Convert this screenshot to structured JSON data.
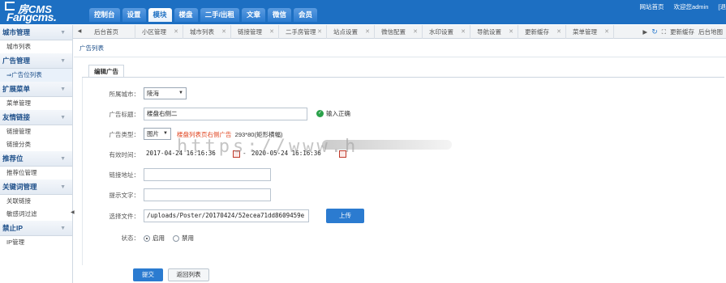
{
  "logo": {
    "line1": "房CMS",
    "line2": "Fangcms."
  },
  "nav": [
    "控制台",
    "设置",
    "模块",
    "楼盘",
    "二手/出租",
    "文章",
    "微信",
    "会员"
  ],
  "nav_active_index": 2,
  "top_links": [
    "网站首页",
    "欢迎您admin",
    "[退"
  ],
  "tabs": [
    "后台首页",
    "小区管理",
    "城市列表",
    "链接管理",
    "二手房管理",
    "站点设置",
    "微信配置",
    "水印设置",
    "导航设置",
    "更新缓存",
    "菜单管理"
  ],
  "tab_tools": {
    "refresh": "更新缓存",
    "map": "后台地图"
  },
  "sidebar": {
    "groups": [
      {
        "title": "城市管理",
        "items": [
          "城市列表"
        ]
      },
      {
        "title": "广告管理",
        "items": [
          "⇒广告位列表"
        ]
      },
      {
        "title": "扩展菜单",
        "items": [
          "菜单管理"
        ]
      },
      {
        "title": "友情链接",
        "items": [
          "链接管理",
          "链接分类"
        ]
      },
      {
        "title": "推荐位",
        "items": [
          "推荐位管理"
        ]
      },
      {
        "title": "关键词管理",
        "items": [
          "关联链接",
          "敏感词过滤"
        ]
      },
      {
        "title": "禁止IP",
        "items": [
          "IP管理"
        ]
      }
    ]
  },
  "breadcrumb": "广告列表",
  "form_tab": "编辑广告",
  "form": {
    "city": {
      "label": "所属城市：",
      "value": "陵海"
    },
    "title": {
      "label": "广告标题：",
      "value": "楼盘右侧二",
      "ok_text": "输入正确"
    },
    "type": {
      "label": "广告类型：",
      "value": "图片",
      "hint_red": "楼盘列表页右侧广告",
      "hint_black": "293*80(矩形横幅)"
    },
    "time": {
      "label": "有效时间：",
      "start": "2017-04-24 16:16:36",
      "sep": "-",
      "end": "2020-05-24 16:16:36"
    },
    "link": {
      "label": "链接地址：",
      "value": ""
    },
    "tip": {
      "label": "提示文字：",
      "value": ""
    },
    "file": {
      "label": "选择文件：",
      "value": "/uploads/Poster/20170424/52ecea71dd8609459e",
      "upload": "上传"
    },
    "status": {
      "label": "状态：",
      "options": [
        "启用",
        "禁用"
      ],
      "selected": 0
    }
  },
  "actions": {
    "submit": "提交",
    "back": "返回列表"
  },
  "watermark": "https://www.h"
}
